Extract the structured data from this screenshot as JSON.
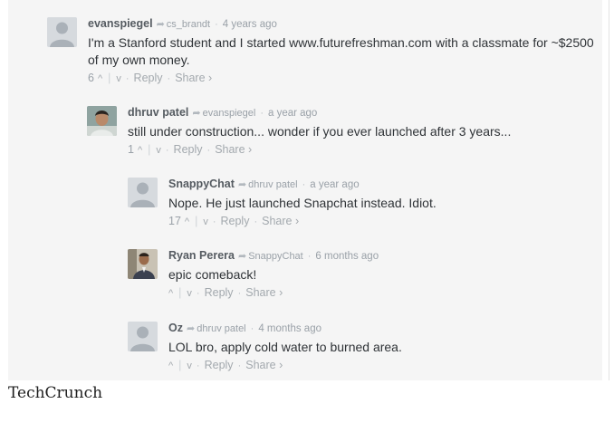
{
  "comments": [
    {
      "author": "evanspiegel",
      "reply_to": "cs_brandt",
      "time": "4 years ago",
      "text": "I'm a Stanford student and I started www.futurefreshman.com with a classmate for ~$2500 of my own money.",
      "votes": "6",
      "avatar": "default-avatar-icon"
    },
    {
      "author": "dhruv patel",
      "reply_to": "evanspiegel",
      "time": "a year ago",
      "text": "still under construction... wonder if you ever launched after 3 years...",
      "votes": "1",
      "avatar": "user-photo-avatar"
    },
    {
      "author": "SnappyChat",
      "reply_to": "dhruv patel",
      "time": "a year ago",
      "text": "Nope. He just launched Snapchat instead. Idiot.",
      "votes": "17",
      "avatar": "default-avatar-icon"
    },
    {
      "author": "Ryan Perera",
      "reply_to": "SnappyChat",
      "time": "6 months ago",
      "text": "epic comeback!",
      "votes": "",
      "avatar": "user-photo-avatar"
    },
    {
      "author": "Oz",
      "reply_to": "dhruv patel",
      "time": "4 months ago",
      "text": "LOL bro, apply cold water to burned area.",
      "votes": "",
      "avatar": "default-avatar-icon"
    }
  ],
  "actions": {
    "upvote": "^",
    "downvote": "v",
    "reply": "Reply",
    "share": "Share ›",
    "separator": "·",
    "reply_arrow": "➦"
  },
  "caption": "TechCrunch"
}
